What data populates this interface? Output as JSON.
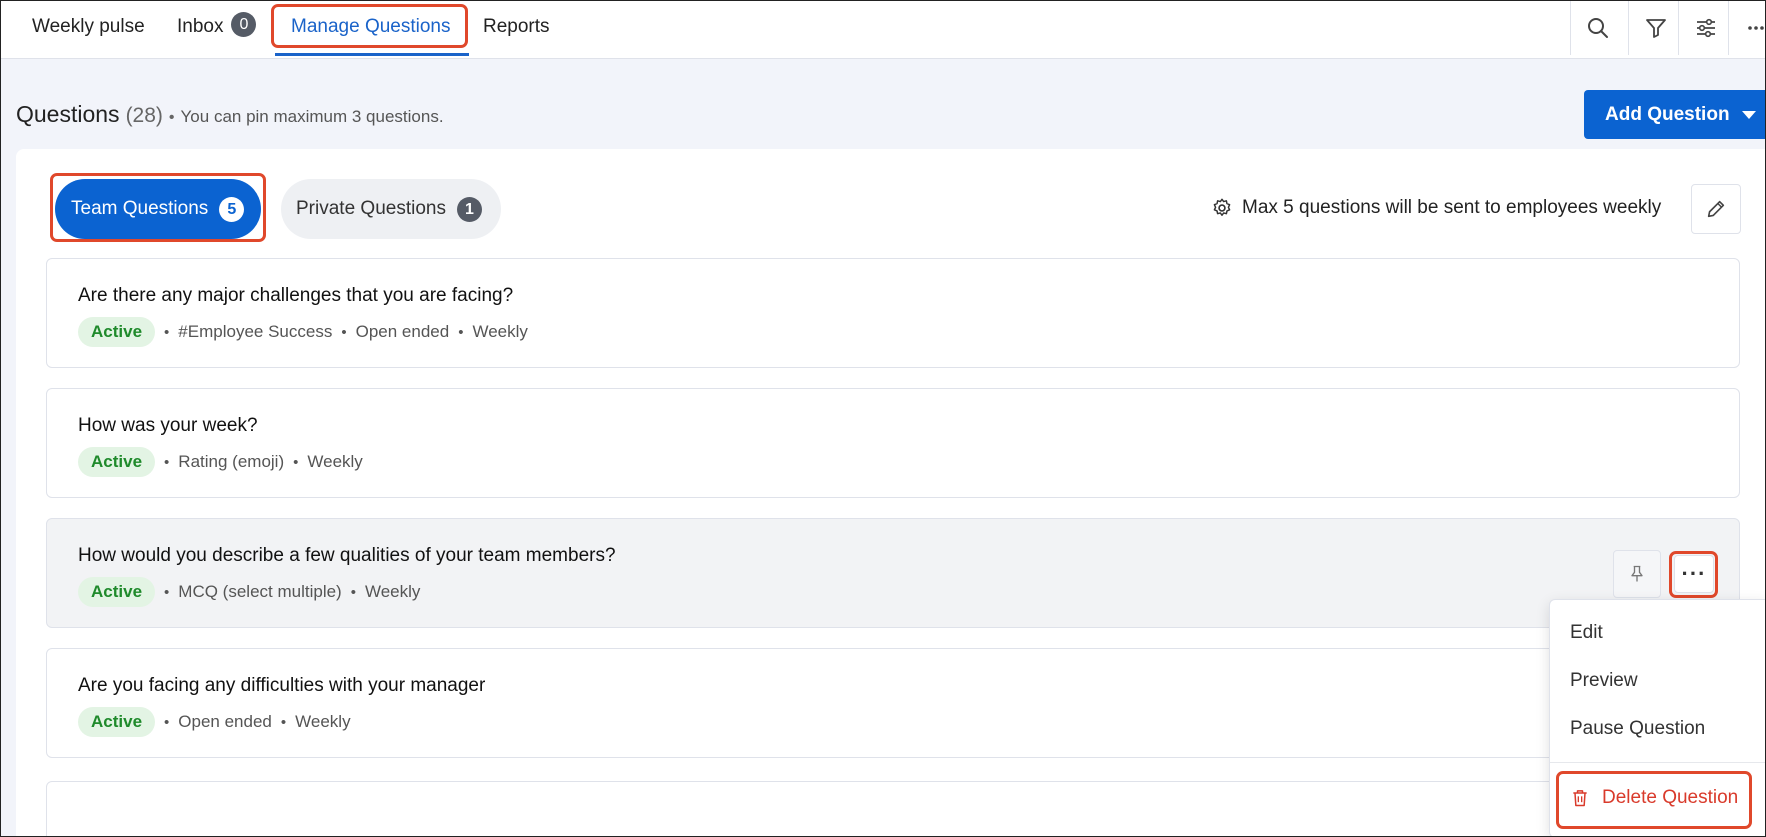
{
  "nav": {
    "tabs": [
      {
        "label": "Weekly pulse"
      },
      {
        "label": "Inbox",
        "badge": "0"
      },
      {
        "label": "Manage Questions",
        "active": true
      },
      {
        "label": "Reports"
      }
    ],
    "tools": [
      "search-icon",
      "filter-icon",
      "sliders-icon",
      "more-horizontal-icon"
    ]
  },
  "header": {
    "title": "Questions",
    "count": "(28)",
    "hint": "You can pin maximum 3 questions.",
    "add_button": "Add Question"
  },
  "filters": {
    "team": {
      "label": "Team Questions",
      "count": "5"
    },
    "private": {
      "label": "Private Questions",
      "count": "1"
    }
  },
  "settings_note": "Max 5 questions will be sent to employees weekly",
  "questions": [
    {
      "title": "Are there any major challenges that you are facing?",
      "status": "Active",
      "meta": [
        "#Employee Success",
        "Open ended",
        "Weekly"
      ]
    },
    {
      "title": "How was your week?",
      "status": "Active",
      "meta": [
        "Rating (emoji)",
        "Weekly"
      ]
    },
    {
      "title": "How would you describe a few qualities of your team members?",
      "status": "Active",
      "meta": [
        "MCQ (select multiple)",
        "Weekly"
      ]
    },
    {
      "title": "Are you facing any difficulties with your manager",
      "status": "Active",
      "meta": [
        "Open ended",
        "Weekly"
      ]
    }
  ],
  "menu": {
    "edit": "Edit",
    "preview": "Preview",
    "pause": "Pause Question",
    "delete": "Delete Question"
  },
  "colors": {
    "accent": "#0b63d1",
    "active_tab": "#1a63c9",
    "highlight": "#e0482b",
    "status_green": "#1f8a2b",
    "danger": "#d93a2b"
  }
}
